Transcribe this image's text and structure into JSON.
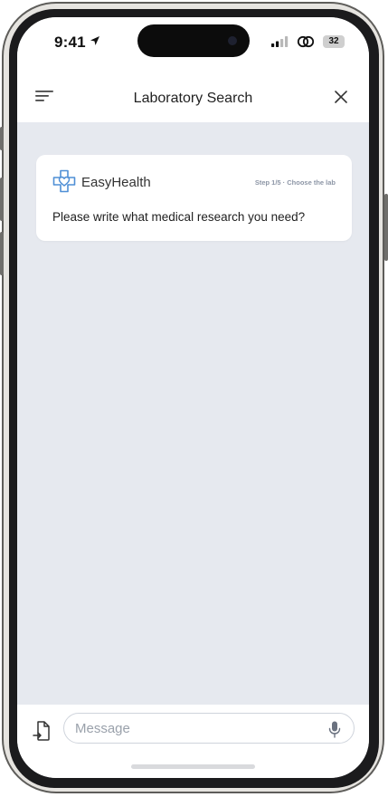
{
  "status_bar": {
    "time": "9:41",
    "battery_level": "32",
    "icons": [
      "location-arrow-icon",
      "signal-bars-icon",
      "link-icon",
      "battery-icon"
    ]
  },
  "header": {
    "title": "Laboratory Search",
    "left_icon": "menu-icon",
    "right_icon": "close-icon"
  },
  "message_card": {
    "brand_name": "EasyHealth",
    "brand_icon": "medical-cross-heart-icon",
    "step_label": "Step 1/5 · Choose the lab",
    "prompt": "Please write what medical research you need?"
  },
  "composer": {
    "placeholder": "Message",
    "attach_icon": "attach-document-icon",
    "mic_icon": "microphone-icon"
  },
  "colors": {
    "chat_background": "#e6e9ef",
    "card_background": "#ffffff",
    "brand_blue": "#4f8fd6",
    "placeholder_gray": "#9aa1ab"
  }
}
